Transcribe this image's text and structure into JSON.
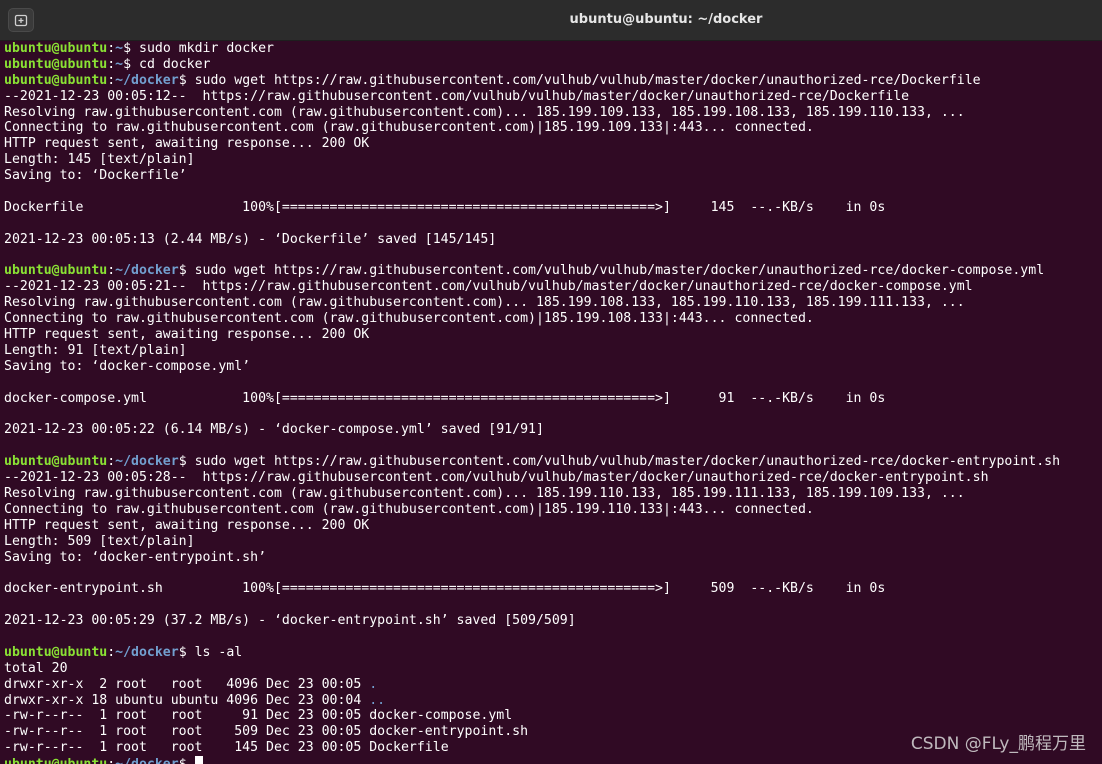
{
  "window": {
    "title": "ubuntu@ubuntu: ~/docker",
    "new_tab_icon": "new-tab-icon"
  },
  "terminal": {
    "lines": [
      {
        "type": "prompt",
        "user": "ubuntu@ubuntu",
        "path": "~",
        "cmd": " sudo mkdir docker"
      },
      {
        "type": "prompt",
        "user": "ubuntu@ubuntu",
        "path": "~",
        "cmd": " cd docker"
      },
      {
        "type": "prompt",
        "user": "ubuntu@ubuntu",
        "path": "~/docker",
        "cmd": " sudo wget https://raw.githubusercontent.com/vulhub/vulhub/master/docker/unauthorized-rce/Dockerfile"
      },
      {
        "type": "text",
        "text": "--2021-12-23 00:05:12--  https://raw.githubusercontent.com/vulhub/vulhub/master/docker/unauthorized-rce/Dockerfile"
      },
      {
        "type": "text",
        "text": "Resolving raw.githubusercontent.com (raw.githubusercontent.com)... 185.199.109.133, 185.199.108.133, 185.199.110.133, ..."
      },
      {
        "type": "text",
        "text": "Connecting to raw.githubusercontent.com (raw.githubusercontent.com)|185.199.109.133|:443... connected."
      },
      {
        "type": "text",
        "text": "HTTP request sent, awaiting response... 200 OK"
      },
      {
        "type": "text",
        "text": "Length: 145 [text/plain]"
      },
      {
        "type": "text",
        "text": "Saving to: ‘Dockerfile’"
      },
      {
        "type": "text",
        "text": ""
      },
      {
        "type": "text",
        "text": "Dockerfile                    100%[===============================================>]     145  --.-KB/s    in 0s"
      },
      {
        "type": "text",
        "text": ""
      },
      {
        "type": "text",
        "text": "2021-12-23 00:05:13 (2.44 MB/s) - ‘Dockerfile’ saved [145/145]"
      },
      {
        "type": "text",
        "text": ""
      },
      {
        "type": "prompt",
        "user": "ubuntu@ubuntu",
        "path": "~/docker",
        "cmd": " sudo wget https://raw.githubusercontent.com/vulhub/vulhub/master/docker/unauthorized-rce/docker-compose.yml"
      },
      {
        "type": "text",
        "text": "--2021-12-23 00:05:21--  https://raw.githubusercontent.com/vulhub/vulhub/master/docker/unauthorized-rce/docker-compose.yml"
      },
      {
        "type": "text",
        "text": "Resolving raw.githubusercontent.com (raw.githubusercontent.com)... 185.199.108.133, 185.199.110.133, 185.199.111.133, ..."
      },
      {
        "type": "text",
        "text": "Connecting to raw.githubusercontent.com (raw.githubusercontent.com)|185.199.108.133|:443... connected."
      },
      {
        "type": "text",
        "text": "HTTP request sent, awaiting response... 200 OK"
      },
      {
        "type": "text",
        "text": "Length: 91 [text/plain]"
      },
      {
        "type": "text",
        "text": "Saving to: ‘docker-compose.yml’"
      },
      {
        "type": "text",
        "text": ""
      },
      {
        "type": "text",
        "text": "docker-compose.yml            100%[===============================================>]      91  --.-KB/s    in 0s"
      },
      {
        "type": "text",
        "text": ""
      },
      {
        "type": "text",
        "text": "2021-12-23 00:05:22 (6.14 MB/s) - ‘docker-compose.yml’ saved [91/91]"
      },
      {
        "type": "text",
        "text": ""
      },
      {
        "type": "prompt",
        "user": "ubuntu@ubuntu",
        "path": "~/docker",
        "cmd": " sudo wget https://raw.githubusercontent.com/vulhub/vulhub/master/docker/unauthorized-rce/docker-entrypoint.sh"
      },
      {
        "type": "text",
        "text": "--2021-12-23 00:05:28--  https://raw.githubusercontent.com/vulhub/vulhub/master/docker/unauthorized-rce/docker-entrypoint.sh"
      },
      {
        "type": "text",
        "text": "Resolving raw.githubusercontent.com (raw.githubusercontent.com)... 185.199.110.133, 185.199.111.133, 185.199.109.133, ..."
      },
      {
        "type": "text",
        "text": "Connecting to raw.githubusercontent.com (raw.githubusercontent.com)|185.199.110.133|:443... connected."
      },
      {
        "type": "text",
        "text": "HTTP request sent, awaiting response... 200 OK"
      },
      {
        "type": "text",
        "text": "Length: 509 [text/plain]"
      },
      {
        "type": "text",
        "text": "Saving to: ‘docker-entrypoint.sh’"
      },
      {
        "type": "text",
        "text": ""
      },
      {
        "type": "text",
        "text": "docker-entrypoint.sh          100%[===============================================>]     509  --.-KB/s    in 0s"
      },
      {
        "type": "text",
        "text": ""
      },
      {
        "type": "text",
        "text": "2021-12-23 00:05:29 (37.2 MB/s) - ‘docker-entrypoint.sh’ saved [509/509]"
      },
      {
        "type": "text",
        "text": ""
      },
      {
        "type": "prompt",
        "user": "ubuntu@ubuntu",
        "path": "~/docker",
        "cmd": " ls -al"
      },
      {
        "type": "text",
        "text": "total 20"
      },
      {
        "type": "ls",
        "text": "drwxr-xr-x  2 root   root   4096 Dec 23 00:05 ",
        "name": ".",
        "dir": true
      },
      {
        "type": "ls",
        "text": "drwxr-xr-x 18 ubuntu ubuntu 4096 Dec 23 00:04 ",
        "name": "..",
        "dir": true
      },
      {
        "type": "ls",
        "text": "-rw-r--r--  1 root   root     91 Dec 23 00:05 ",
        "name": "docker-compose.yml",
        "dir": false
      },
      {
        "type": "ls",
        "text": "-rw-r--r--  1 root   root    509 Dec 23 00:05 ",
        "name": "docker-entrypoint.sh",
        "dir": false
      },
      {
        "type": "ls",
        "text": "-rw-r--r--  1 root   root    145 Dec 23 00:05 ",
        "name": "Dockerfile",
        "dir": false
      },
      {
        "type": "prompt",
        "user": "ubuntu@ubuntu",
        "path": "~/docker",
        "cmd": " ",
        "cursor": true
      }
    ]
  },
  "watermark": "CSDN @FLy_鹏程万里",
  "colors": {
    "background": "#300a24",
    "user": "#8ae234",
    "path": "#729fcf",
    "text": "#ffffff"
  }
}
